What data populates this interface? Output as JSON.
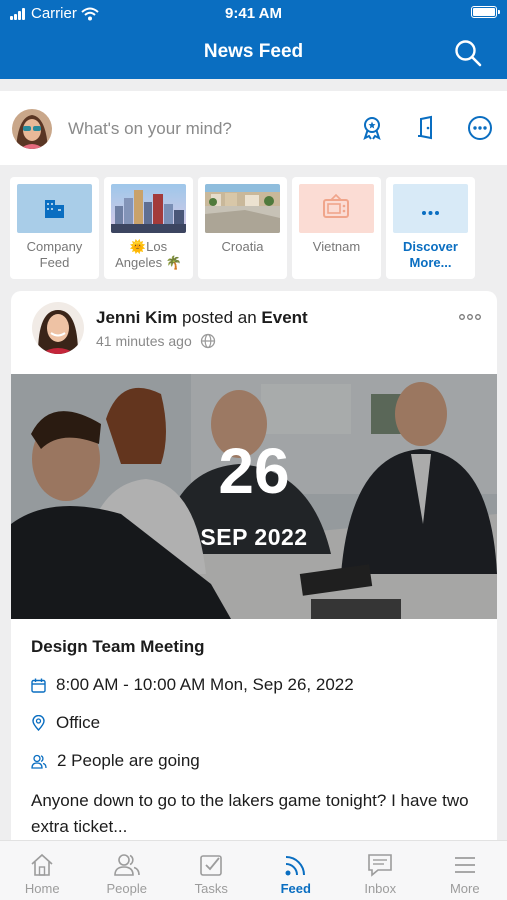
{
  "status_bar": {
    "carrier": "Carrier",
    "time": "9:41 AM"
  },
  "header": {
    "title": "News Feed"
  },
  "composer": {
    "placeholder": "What's on your mind?"
  },
  "quick_links": [
    {
      "label": "Company Feed",
      "icon": "building-icon"
    },
    {
      "label": "🌞Los Angeles 🌴",
      "icon": "city-photo"
    },
    {
      "label": "Croatia",
      "icon": "coast-photo"
    },
    {
      "label": "Vietnam",
      "icon": "tv-icon"
    },
    {
      "label": "Discover More...",
      "icon": "more-icon"
    }
  ],
  "post": {
    "author": "Jenni Kim",
    "action": "posted an",
    "object": "Event",
    "time_ago": "41 minutes ago",
    "event": {
      "day": "26",
      "month_year": "SEP 2022",
      "title": "Design Team Meeting",
      "time_range": "8:00 AM - 10:00 AM Mon, Sep 26, 2022",
      "location": "Office",
      "going": "2 People are going"
    },
    "text": "Anyone down to go to the lakers game tonight? I have two extra ticket..."
  },
  "tabs": [
    {
      "label": "Home",
      "icon": "home-icon",
      "active": false
    },
    {
      "label": "People",
      "icon": "people-icon",
      "active": false
    },
    {
      "label": "Tasks",
      "icon": "tasks-icon",
      "active": false
    },
    {
      "label": "Feed",
      "icon": "feed-icon",
      "active": true
    },
    {
      "label": "Inbox",
      "icon": "inbox-icon",
      "active": false
    },
    {
      "label": "More",
      "icon": "menu-icon",
      "active": false
    }
  ],
  "colors": {
    "brand": "#0a6ec1",
    "background": "#eeeeef"
  }
}
